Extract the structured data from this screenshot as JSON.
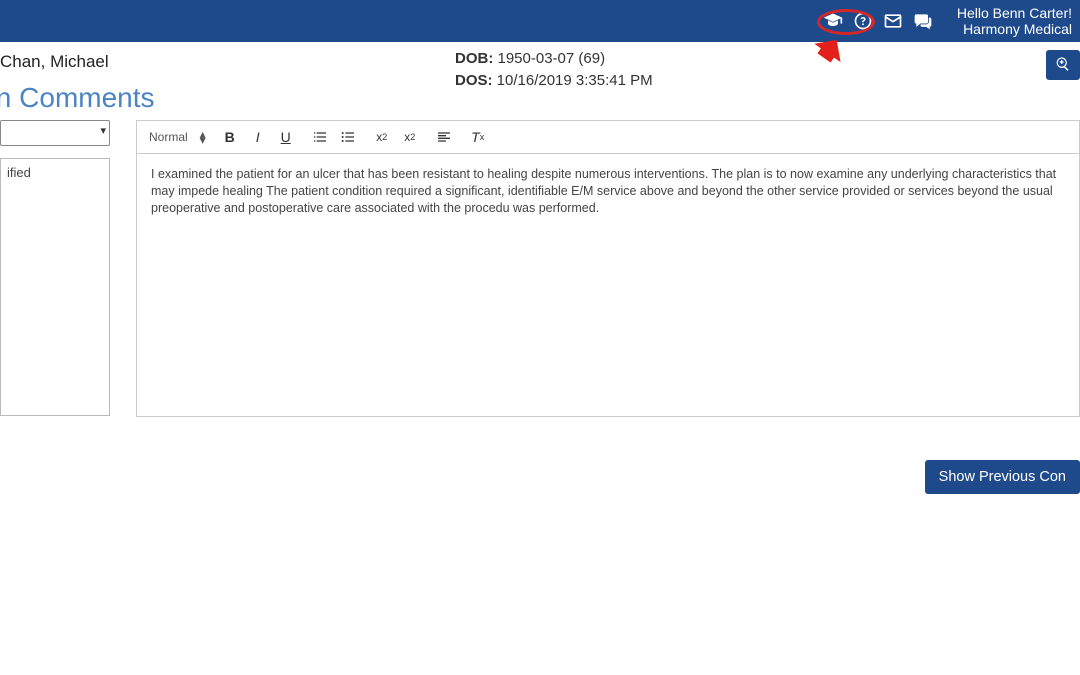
{
  "header": {
    "greeting": "Hello Benn Carter!",
    "org": "Harmony Medical"
  },
  "patient": {
    "name": "Chan, Michael",
    "dob_label": "DOB:",
    "dob_value": "1950-03-07 (69)",
    "dos_label": "DOS:",
    "dos_value": "10/16/2019 3:35:41 PM"
  },
  "section": {
    "title": "cian Comments"
  },
  "sidebar": {
    "select_placeholder": "",
    "textarea_value": "ified"
  },
  "toolbar": {
    "style_label": "Normal"
  },
  "editor": {
    "content": "I examined the patient for an ulcer that has been resistant to healing despite numerous interventions. The plan is to now examine any underlying characteristics that may impede healing The patient condition required a significant, identifiable E/M service above and beyond the other service provided or services beyond the usual preoperative and postoperative care associated with the procedu was performed."
  },
  "buttons": {
    "show_previous": "Show Previous Con"
  }
}
